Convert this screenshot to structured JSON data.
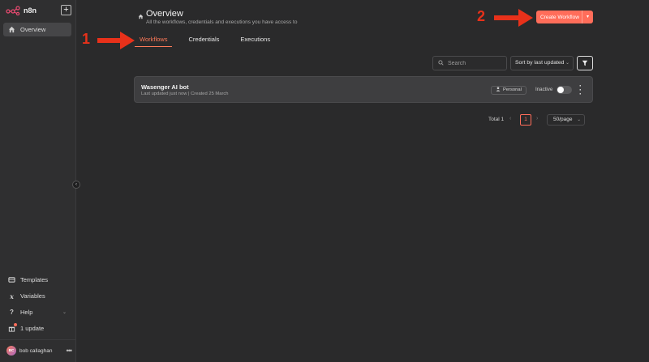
{
  "app": {
    "name": "n8n",
    "add_label": "+"
  },
  "sidebar": {
    "items": [
      {
        "label": "Overview",
        "icon": "home-icon"
      },
      {
        "label": "Templates",
        "icon": "templates-icon"
      },
      {
        "label": "Variables",
        "icon": "variables-icon"
      },
      {
        "label": "Help",
        "icon": "help-icon"
      },
      {
        "label": "1 update",
        "icon": "gift-icon"
      }
    ],
    "user": {
      "initials": "BC",
      "name": "bob callaghan",
      "more": "•••"
    }
  },
  "header": {
    "title": "Overview",
    "subtitle": "All the workflows, credentials and executions you have access to",
    "create_label": "Create Workflow"
  },
  "tabs": [
    {
      "label": "Workflows",
      "active": true
    },
    {
      "label": "Credentials",
      "active": false
    },
    {
      "label": "Executions",
      "active": false
    }
  ],
  "controls": {
    "search_placeholder": "Search",
    "sort_label": "Sort by last updated"
  },
  "workflows": [
    {
      "title": "Wasenger AI bot",
      "meta": "Last updated just now | Created 25 March",
      "badge": "Personal",
      "status": "Inactive"
    }
  ],
  "pagination": {
    "total": "Total 1",
    "current": "1",
    "per_page": "50/page"
  },
  "annotations": [
    {
      "number": "1",
      "color": "#e8311a"
    },
    {
      "number": "2",
      "color": "#e8311a"
    }
  ],
  "colors": {
    "accent": "#ff6d5a",
    "background": "#2a2a2b",
    "sidebar": "#2f2f30"
  }
}
